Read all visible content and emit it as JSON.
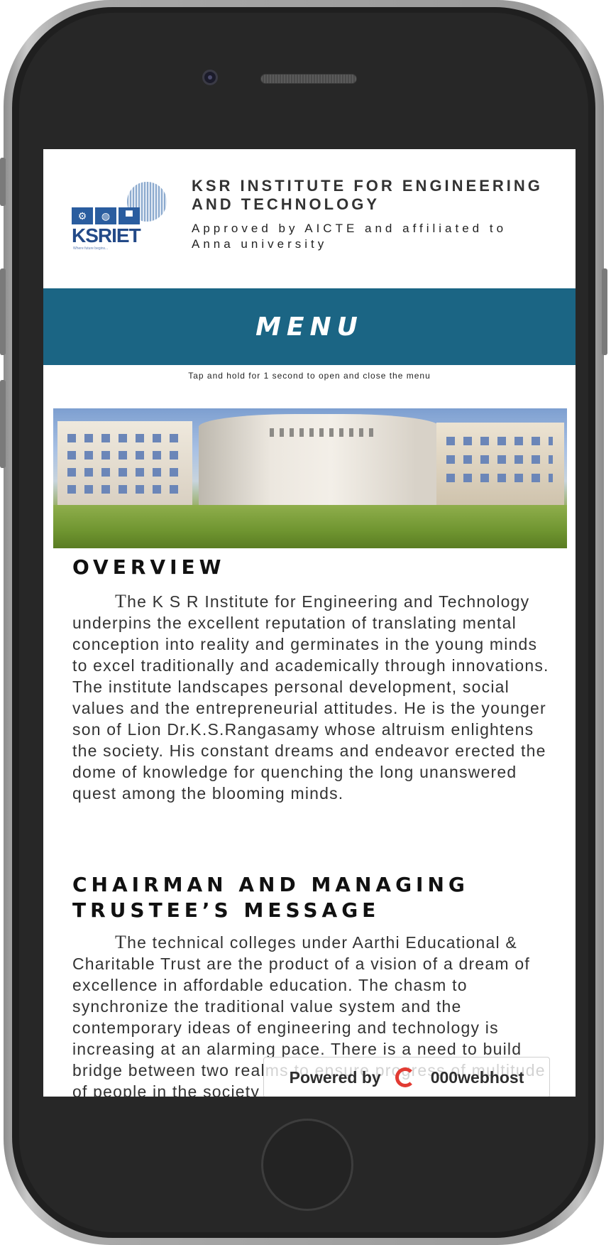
{
  "header": {
    "logo_text": "KSRIET",
    "logo_tagline": "Where future begins...",
    "institute_name": "KSR INSTITUTE FOR ENGINEERING AND TECHNOLOGY",
    "subtitle": "Approved by  AICTE and affiliated to Anna university"
  },
  "menu": {
    "label": "MENU",
    "hint": "Tap and hold for 1 second to open and close the menu"
  },
  "banner": {
    "icon": "campus-building-photo"
  },
  "overview": {
    "title": "OVERVIEW",
    "text": "The K S R Institute for Engineering and Technology underpins the excellent reputation of translating mental conception into reality and germinates in the young minds to excel traditionally and academically through innovations. The institute landscapes personal development, social values and the entrepreneurial attitudes. He is the younger son of Lion Dr.K.S.Rangasamy whose altruism enlightens the society. His constant dreams and endeavor erected the dome of knowledge for quenching the long unanswered quest among the blooming minds."
  },
  "chairman": {
    "title": "CHAIRMAN AND MANAGING TRUSTEE’S MESSAGE",
    "text": "The technical colleges under Aarthi Educational & Charitable Trust are the product of a vision of a dream of excellence in affordable education. The chasm to synchronize the traditional value system and the contemporary ideas of engineering and technology is increasing at an alarming pace. There is a need to build bridge between two realms to ensure progress of multitude of people in the society"
  },
  "powered_badge": {
    "prefix": "Powered by",
    "brand": "000webhost"
  }
}
